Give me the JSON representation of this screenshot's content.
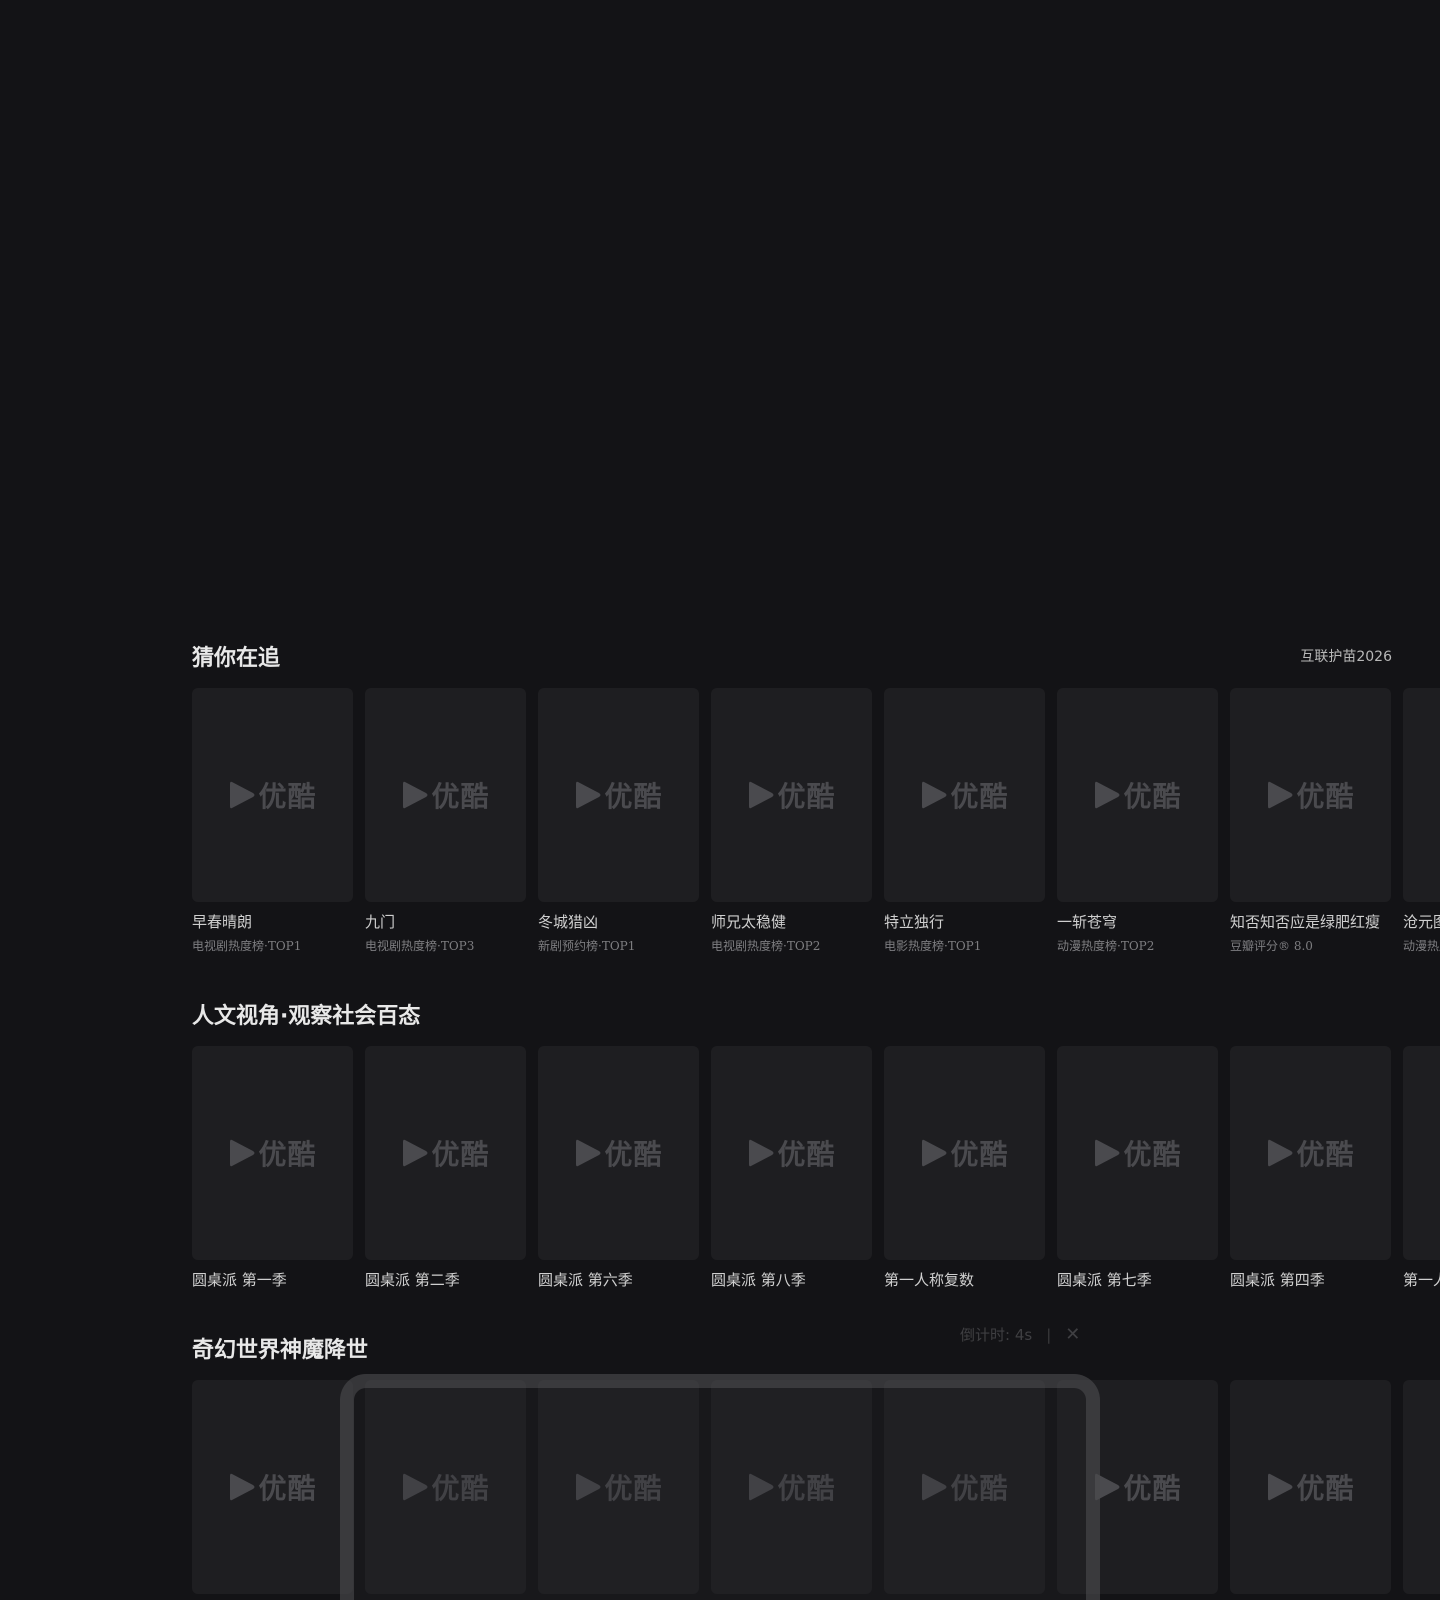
{
  "logo_text": "优酷",
  "sections": [
    {
      "title": "猜你在追",
      "extra": "互联护苗2026",
      "items": [
        {
          "title": "早春晴朗",
          "sub": "电视剧热度榜·TOP1"
        },
        {
          "title": "九门",
          "sub": "电视剧热度榜·TOP3"
        },
        {
          "title": "冬城猎凶",
          "sub": "新剧预约榜·TOP1"
        },
        {
          "title": "师兄太稳健",
          "sub": "电视剧热度榜·TOP2"
        },
        {
          "title": "特立独行",
          "sub": "电影热度榜·TOP1"
        },
        {
          "title": "一斩苍穹",
          "sub": "动漫热度榜·TOP2"
        },
        {
          "title": "知否知否应是绿肥红瘦",
          "sub": "豆瓣评分® 8.0"
        },
        {
          "title": "沧元图",
          "sub": "动漫热度榜"
        }
      ]
    },
    {
      "title": "人文视角·观察社会百态",
      "items": [
        {
          "title": "圆桌派 第一季"
        },
        {
          "title": "圆桌派 第二季"
        },
        {
          "title": "圆桌派 第六季"
        },
        {
          "title": "圆桌派 第八季"
        },
        {
          "title": "第一人称复数"
        },
        {
          "title": "圆桌派 第七季"
        },
        {
          "title": "圆桌派 第四季"
        },
        {
          "title": "第一人称复数"
        }
      ]
    },
    {
      "title": "奇幻世界神魔降世",
      "items": [
        {
          "title": ""
        },
        {
          "title": ""
        },
        {
          "title": ""
        },
        {
          "title": ""
        },
        {
          "title": ""
        },
        {
          "title": ""
        },
        {
          "title": ""
        },
        {
          "title": ""
        }
      ]
    }
  ],
  "countdown": {
    "label": "倒计时: 4s",
    "separator": "|",
    "close": "✕"
  }
}
